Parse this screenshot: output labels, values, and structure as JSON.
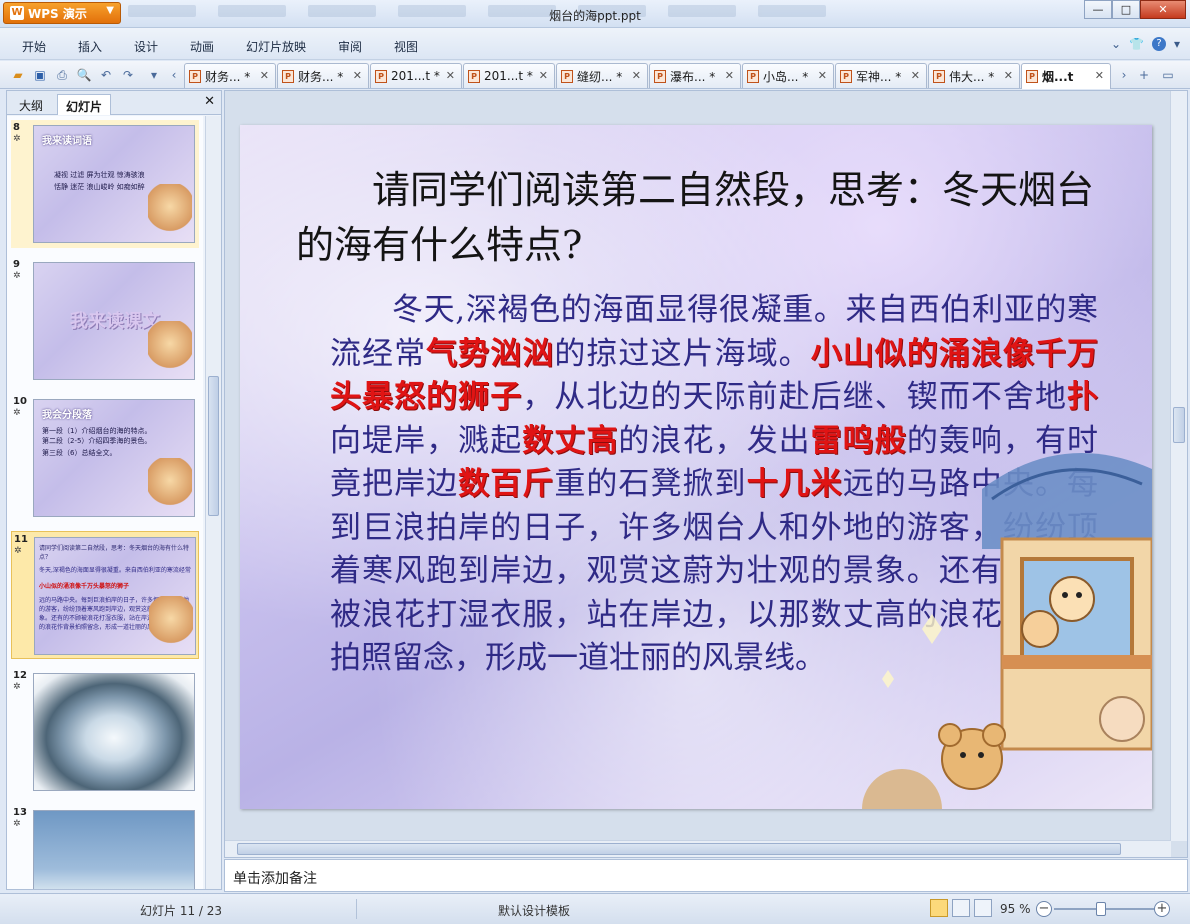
{
  "app": {
    "badge": "WPS 演示",
    "window_title": "烟台的海ppt.ppt"
  },
  "menu": [
    "开始",
    "插入",
    "设计",
    "动画",
    "幻灯片放映",
    "审阅",
    "视图"
  ],
  "doc_tabs": [
    "财务... *",
    "财务... *",
    "201...t *",
    "201...t *",
    "缝纫... *",
    "瀑布... *",
    "小岛... *",
    "军神... *",
    "伟大... *",
    "烟...t"
  ],
  "left_panel": {
    "tabs": [
      "大纲",
      "幻灯片"
    ],
    "slides": [
      {
        "num": "8",
        "title": "我来读词语",
        "lines": [
          "凝视  过滤  屏为壮观  惊涛骇浪",
          "恬静  迷茫  浪山峻岭  如痴如醉"
        ]
      },
      {
        "num": "9",
        "big": "我来读课文"
      },
      {
        "num": "10",
        "title": "我会分段落",
        "lines": [
          "第一段（1）介绍烟台的海的特点。",
          "第二段（2-5）介绍四季海的景色。",
          "第三段（6）总结全文。"
        ]
      },
      {
        "num": "11",
        "text": "请同学们阅读第二自然段，思考：冬天烟台的海有什么特点？"
      },
      {
        "num": "12"
      },
      {
        "num": "13"
      }
    ]
  },
  "slide": {
    "question": "请同学们阅读第二自然段，思考：冬天烟台的海有什么特点?",
    "p1": "冬天,深褐色的海面显得很凝重。来自西伯利亚的寒流经常",
    "h1": "气势汹汹",
    "p2": "的掠过这片海域。",
    "h2": "小山似的涌浪像千万头暴怒的狮子",
    "p3": "，从北边的天际前赴后继、锲而不舍地",
    "h3": "扑",
    "p4": "向堤岸，溅起",
    "h4": "数丈高",
    "p5": "的浪花，发出",
    "h5": "雷鸣般",
    "p6": "的轰响，有时竟把岸边",
    "h6": "数百斤",
    "p7": "重的石凳掀到",
    "h7": "十几米",
    "p8": "远的马路中央。每到巨浪拍岸的日子，许多烟台人和外地的游客，纷纷顶着寒风跑到岸边，观赏这蔚为壮观的景象。还有的不顾被浪花打湿衣服，站在岸边，以那数丈高的浪花作背景拍照留念，形成一道壮丽的风景线。"
  },
  "notes_placeholder": "单击添加备注",
  "status": {
    "slide_counter": "幻灯片 11 / 23",
    "template": "默认设计模板",
    "zoom": "95 %"
  }
}
